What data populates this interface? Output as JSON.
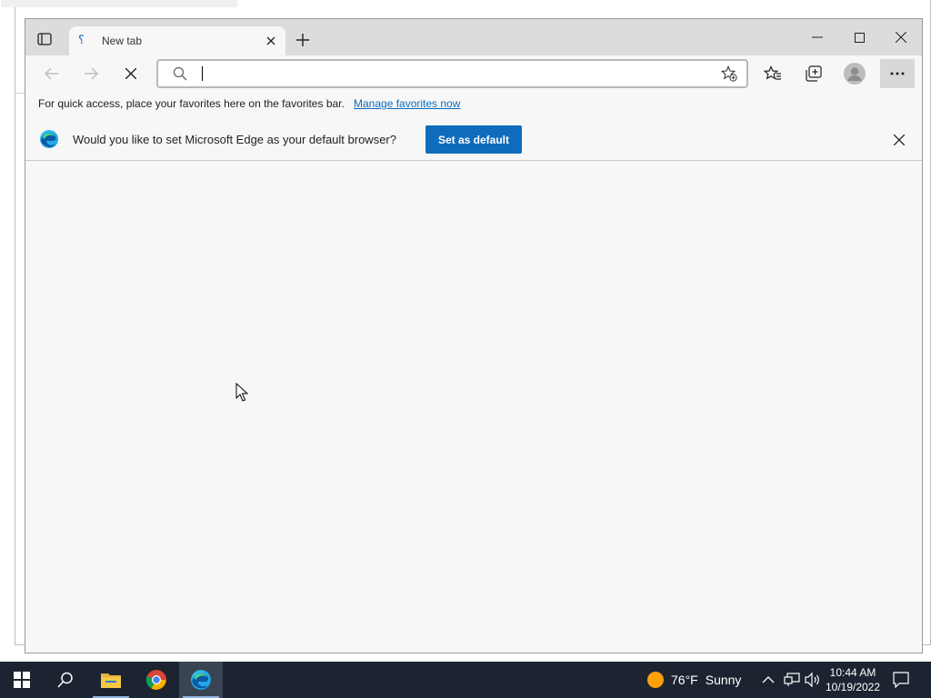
{
  "browser": {
    "tab": {
      "title": "New tab"
    },
    "omnibox": {
      "value": "",
      "placeholder": ""
    },
    "favorites_bar": {
      "message": "For quick access, place your favorites here on the favorites bar.",
      "link": "Manage favorites now"
    },
    "infobar": {
      "question": "Would you like to set Microsoft Edge as your default browser?",
      "button": "Set as default"
    }
  },
  "taskbar": {
    "weather": {
      "temp": "76°F",
      "condition": "Sunny"
    },
    "clock": {
      "time": "10:44 AM",
      "date": "10/19/2022"
    }
  },
  "colors": {
    "accent": "#0f6cbd",
    "taskbar": "#1b2430",
    "titlebar": "#dcdcdc",
    "page": "#f7f7f7"
  },
  "icons": [
    "tab-actions-icon",
    "close-icon",
    "plus-icon",
    "minimize-icon",
    "maximize-icon",
    "back-icon",
    "forward-icon",
    "stop-icon",
    "search-icon",
    "add-favorite-icon",
    "favorites-icon",
    "collections-icon",
    "profile-icon",
    "more-icon",
    "edge-logo-icon",
    "start-icon",
    "file-explorer-icon",
    "chrome-icon",
    "edge-icon",
    "chevron-up-icon",
    "network-icon",
    "volume-icon",
    "notifications-icon"
  ]
}
